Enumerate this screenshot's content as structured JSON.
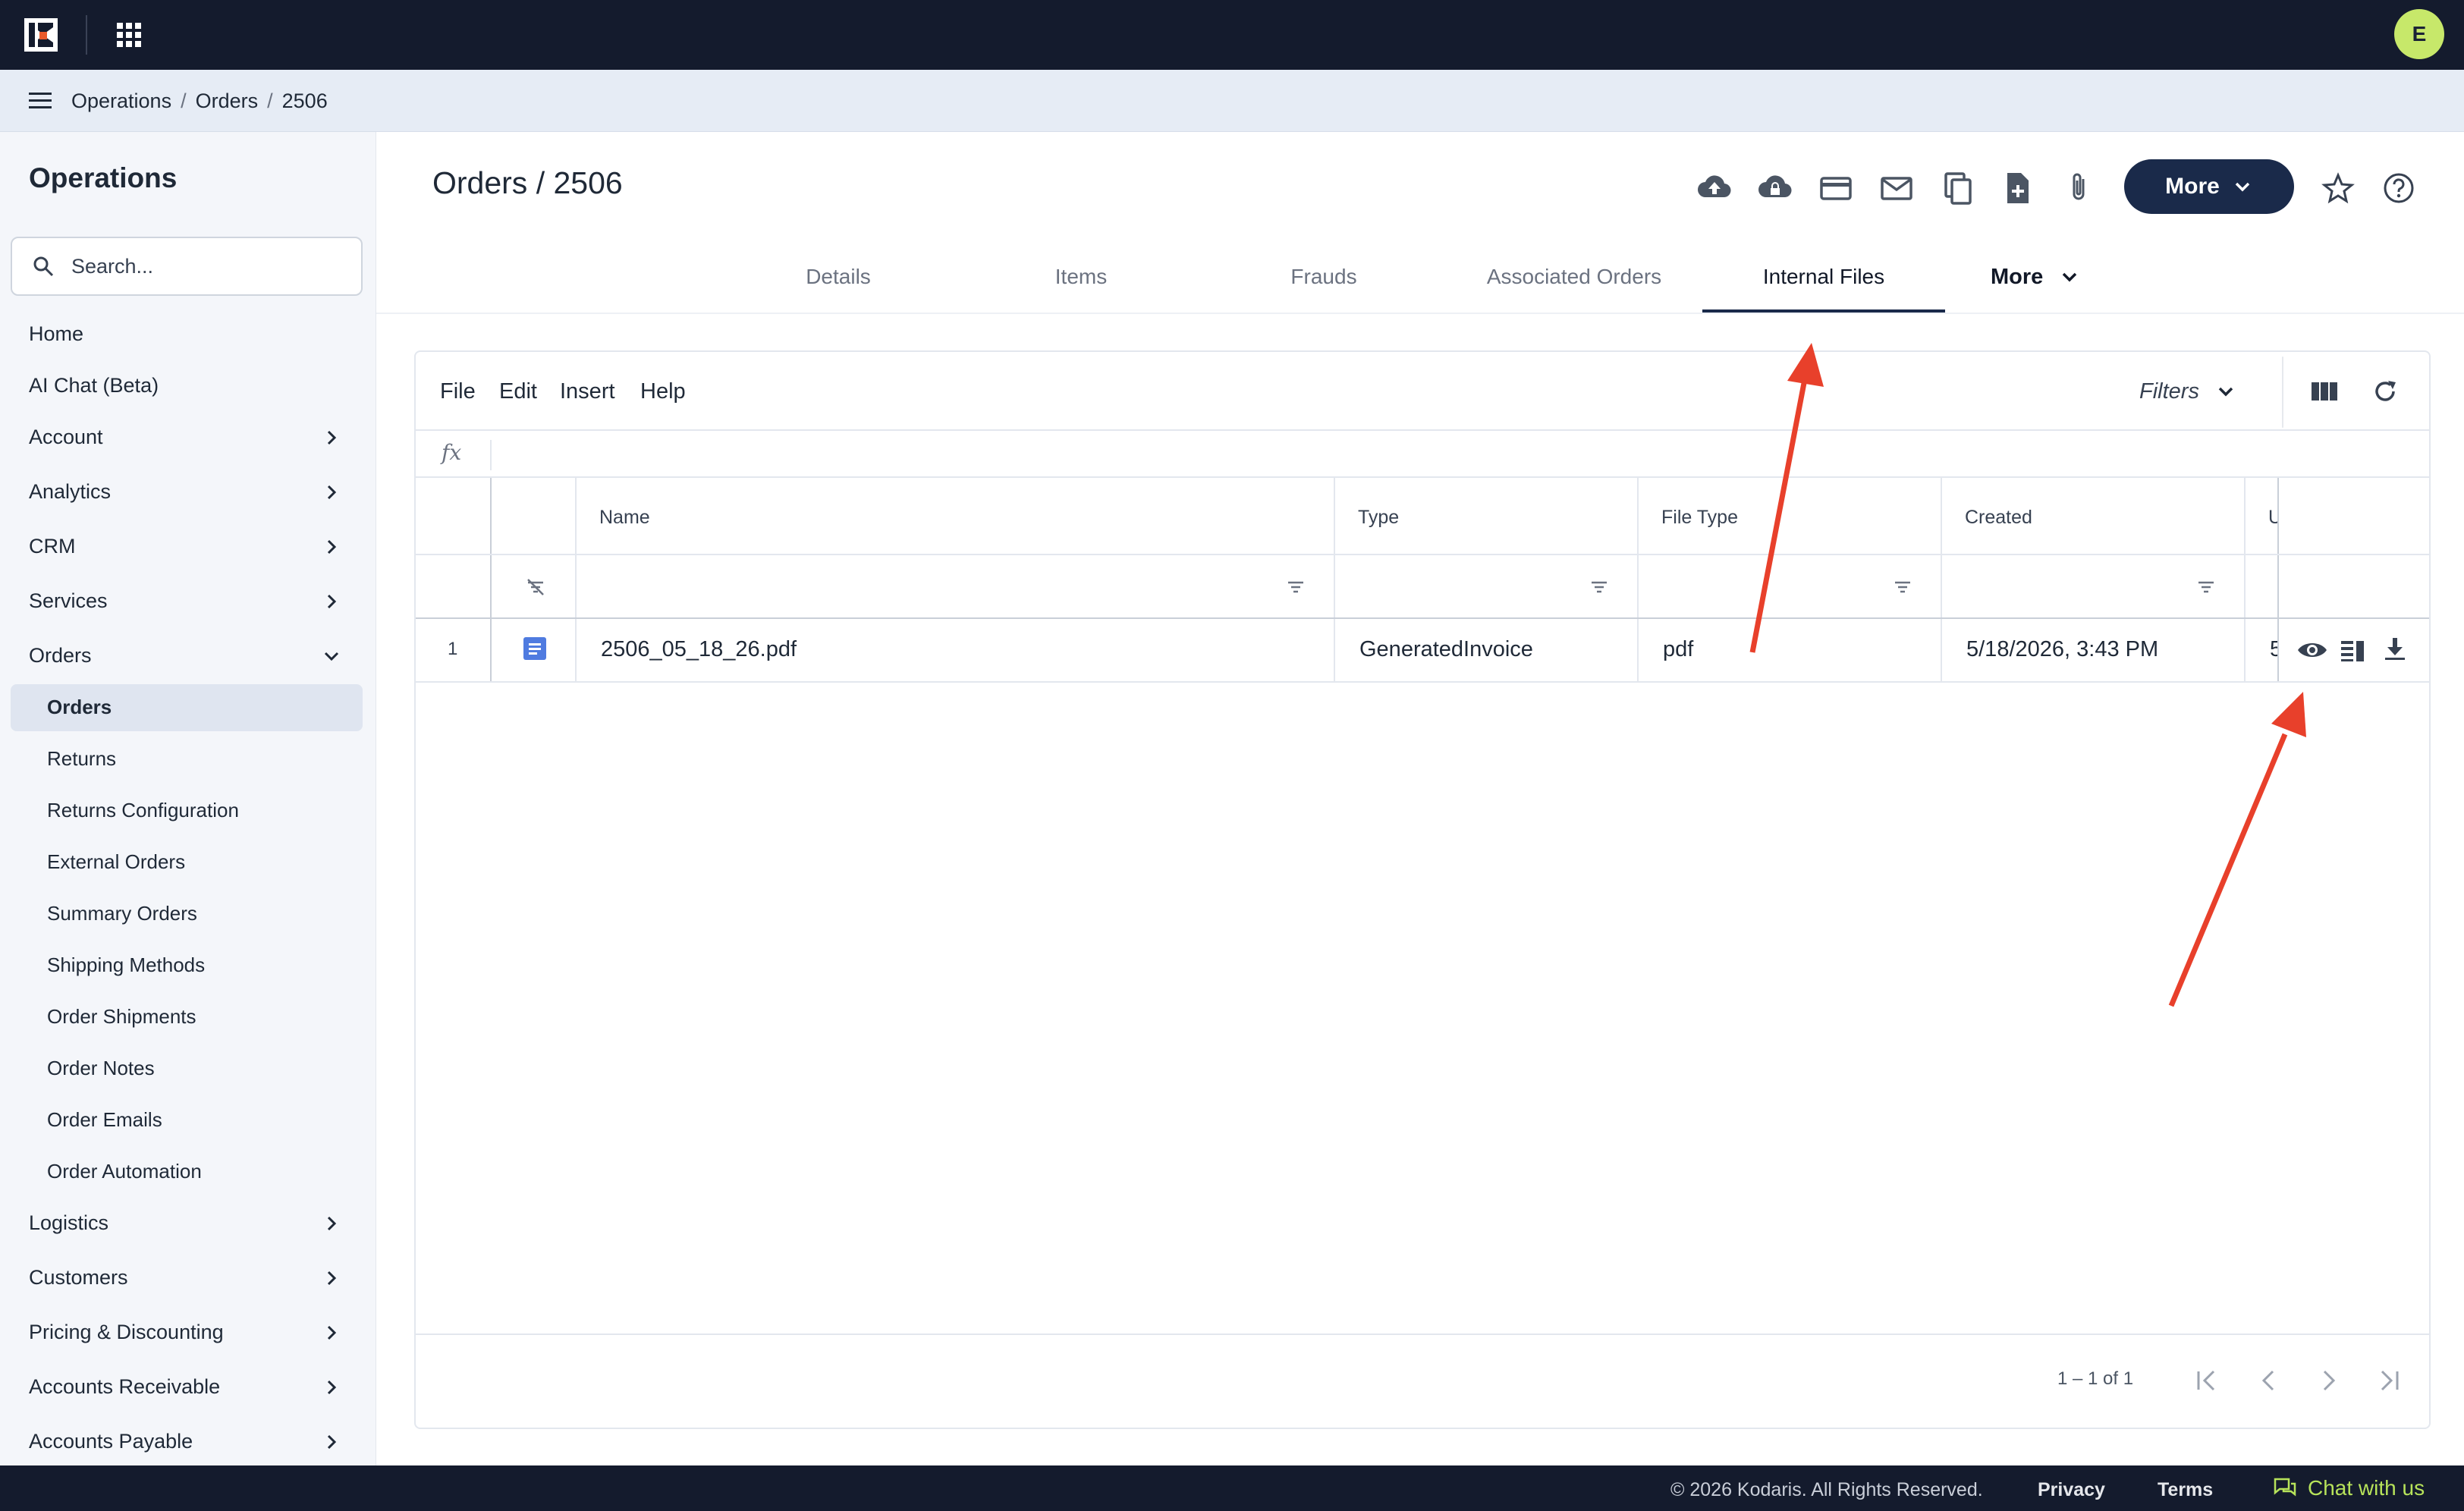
{
  "topbar": {
    "avatar_initial": "E"
  },
  "breadcrumb": {
    "items": [
      "Operations",
      "Orders",
      "2506"
    ],
    "sep": "/"
  },
  "sidebar": {
    "title": "Operations",
    "search_placeholder": "Search...",
    "items": [
      {
        "label": "Home"
      },
      {
        "label": "AI Chat (Beta)"
      },
      {
        "label": "Account"
      },
      {
        "label": "Analytics"
      },
      {
        "label": "CRM"
      },
      {
        "label": "Services"
      },
      {
        "label": "Orders"
      },
      {
        "label": "Logistics"
      },
      {
        "label": "Customers"
      },
      {
        "label": "Pricing & Discounting"
      },
      {
        "label": "Accounts Receivable"
      },
      {
        "label": "Accounts Payable"
      }
    ],
    "orders_sub": [
      {
        "label": "Orders"
      },
      {
        "label": "Returns"
      },
      {
        "label": "Returns Configuration"
      },
      {
        "label": "External Orders"
      },
      {
        "label": "Summary Orders"
      },
      {
        "label": "Shipping Methods"
      },
      {
        "label": "Order Shipments"
      },
      {
        "label": "Order Notes"
      },
      {
        "label": "Order Emails"
      },
      {
        "label": "Order Automation"
      }
    ]
  },
  "header": {
    "title": "Orders / 2506",
    "more_label": "More"
  },
  "tabs": {
    "items": [
      "Details",
      "Items",
      "Frauds",
      "Associated Orders",
      "Internal Files"
    ],
    "more": "More",
    "active": "Internal Files"
  },
  "grid": {
    "menu": [
      "File",
      "Edit",
      "Insert",
      "Help"
    ],
    "filters_label": "Filters",
    "fx": "fx",
    "columns": [
      "Name",
      "Type",
      "File Type",
      "Created",
      "U"
    ],
    "rows": [
      {
        "num": "1",
        "name": "2506_05_18_26.pdf",
        "type": "GeneratedInvoice",
        "file_type": "pdf",
        "created": "5/18/2026, 3:43 PM",
        "u": "5"
      }
    ],
    "pager": "1 – 1 of 1"
  },
  "footer": {
    "copyright": "© 2026 Kodaris. All Rights Reserved.",
    "privacy": "Privacy",
    "terms": "Terms",
    "chat": "Chat with us"
  },
  "colors": {
    "topbar": "#141b2d",
    "accent": "#1a2a4a",
    "arrow": "#e8402b",
    "chat": "#b7e35a"
  }
}
